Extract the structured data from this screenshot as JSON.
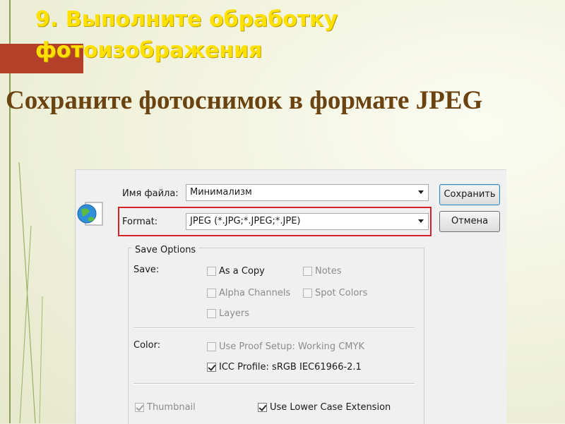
{
  "slide": {
    "title": "9. Выполните обработку фотоизображения",
    "subtitle": "Сохраните фотоснимок в формате JPEG"
  },
  "dialog": {
    "filename_label": "Имя файла:",
    "filename_value": "Минимализм",
    "format_label": "Format:",
    "format_value": "JPEG (*.JPG;*.JPEG;*.JPE)",
    "save_button": "Сохранить",
    "cancel_button": "Отмена",
    "save_options": {
      "group_title": "Save Options",
      "save_label": "Save:",
      "as_copy": {
        "label": "As a Copy",
        "checked": false,
        "enabled": true
      },
      "notes": {
        "label": "Notes",
        "checked": false,
        "enabled": false
      },
      "alpha_channels": {
        "label": "Alpha Channels",
        "checked": false,
        "enabled": false
      },
      "spot_colors": {
        "label": "Spot Colors",
        "checked": false,
        "enabled": false
      },
      "layers": {
        "label": "Layers",
        "checked": false,
        "enabled": false
      },
      "color_label": "Color:",
      "proof_setup": {
        "label": "Use Proof Setup:  Working CMYK",
        "checked": false,
        "enabled": false
      },
      "icc_profile": {
        "label": "ICC Profile:  sRGB IEC61966-2.1",
        "checked": true,
        "enabled": true
      },
      "thumbnail": {
        "label": "Thumbnail",
        "checked": true,
        "enabled": false
      },
      "lower_case": {
        "label": "Use Lower Case Extension",
        "checked": true,
        "enabled": true
      }
    }
  },
  "colors": {
    "title": "#ffe100",
    "subtitle": "#6b4311",
    "accent_tab": "#b5402a",
    "highlight_border": "#d2232a"
  },
  "icons": {
    "globe": "globe-icon",
    "dropdown": "chevron-down-icon"
  }
}
